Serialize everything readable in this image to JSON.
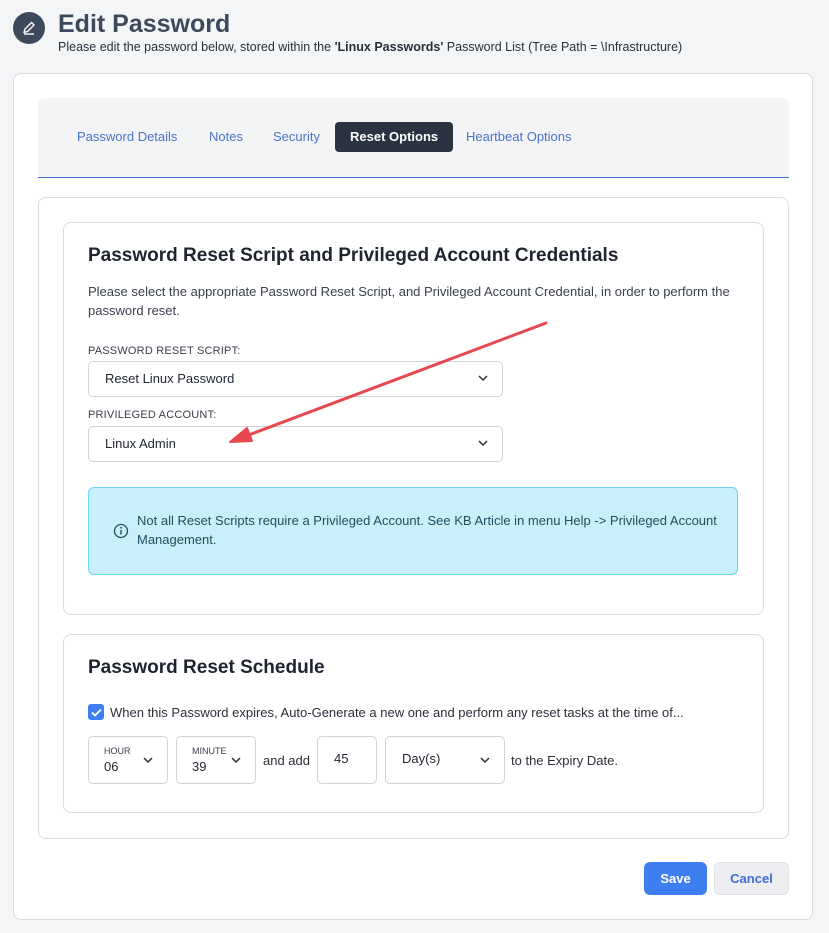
{
  "header": {
    "title": "Edit Password",
    "subtitle_prefix": "Please edit the password below, stored within the ",
    "list_name": "'Linux Passwords'",
    "subtitle_suffix": " Password List (Tree Path = \\Infrastructure)"
  },
  "tabs": [
    {
      "label": "Password Details",
      "active": false
    },
    {
      "label": "Notes",
      "active": false
    },
    {
      "label": "Security",
      "active": false
    },
    {
      "label": "Reset Options",
      "active": true
    },
    {
      "label": "Heartbeat Options",
      "active": false
    }
  ],
  "reset_credentials": {
    "title": "Password Reset Script and Privileged Account Credentials",
    "description": "Please select the appropriate Password Reset Script, and Privileged Account Credential, in order to perform the password reset.",
    "script_label": "PASSWORD RESET SCRIPT:",
    "script_value": "Reset Linux Password",
    "account_label": "PRIVILEGED ACCOUNT:",
    "account_value": "Linux Admin",
    "info_text": "Not all Reset Scripts require a Privileged Account. See KB Article in menu Help -> Privileged Account Management."
  },
  "schedule": {
    "title": "Password Reset Schedule",
    "auto_generate_checked": true,
    "auto_generate_text": "When this Password expires, Auto-Generate a new one and perform any reset tasks at the time of...",
    "hour_label": "HOUR",
    "hour_value": "06",
    "minute_label": "MINUTE",
    "minute_value": "39",
    "and_add_text": "and add",
    "add_amount": "45",
    "unit_value": "Day(s)",
    "suffix_text": "to the Expiry Date."
  },
  "actions": {
    "save_label": "Save",
    "cancel_label": "Cancel"
  },
  "colors": {
    "accent": "#3d7ff0",
    "active_tab": "#2b3342",
    "info_bg": "#c9effa",
    "annotation_arrow": "#e5484d"
  }
}
